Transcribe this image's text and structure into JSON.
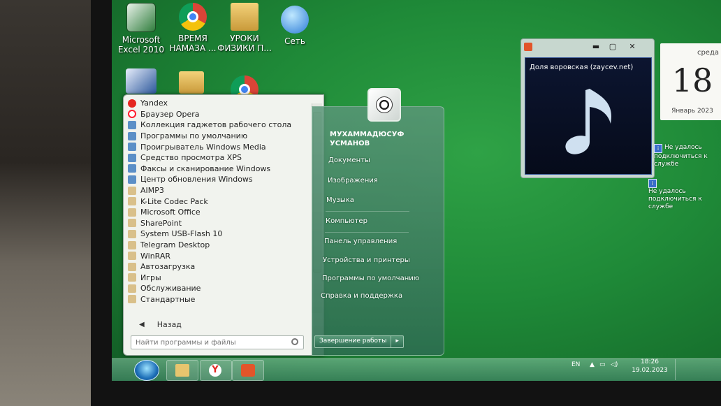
{
  "desktop": {
    "icons": [
      {
        "label": "Microsoft Excel 2010",
        "icon": "excel-icon"
      },
      {
        "label": "ВРЕМЯ НАМАЗА ...",
        "icon": "chrome-icon"
      },
      {
        "label": "УРОКИ ФИЗИКИ П...",
        "icon": "folder-icon"
      },
      {
        "label": "Сеть",
        "icon": "network-icon"
      }
    ]
  },
  "start_menu": {
    "programs": [
      {
        "label": "Yandex",
        "icon": "yandex-icon"
      },
      {
        "label": "Браузер Opera",
        "icon": "opera-icon"
      },
      {
        "label": "Коллекция гаджетов рабочего стола",
        "icon": "gadgets-icon"
      },
      {
        "label": "Программы по умолчанию",
        "icon": "defaults-icon"
      },
      {
        "label": "Проигрыватель Windows Media",
        "icon": "media-player-icon"
      },
      {
        "label": "Средство просмотра XPS",
        "icon": "xps-icon"
      },
      {
        "label": "Факсы и сканирование Windows",
        "icon": "fax-icon"
      },
      {
        "label": "Центр обновления Windows",
        "icon": "update-icon"
      },
      {
        "label": "AIMP3",
        "icon": "folder-icon"
      },
      {
        "label": "K-Lite Codec Pack",
        "icon": "folder-icon"
      },
      {
        "label": "Microsoft Office",
        "icon": "folder-icon"
      },
      {
        "label": "SharePoint",
        "icon": "folder-icon"
      },
      {
        "label": "System USB-Flash 10",
        "icon": "folder-icon"
      },
      {
        "label": "Telegram Desktop",
        "icon": "folder-icon"
      },
      {
        "label": "WinRAR",
        "icon": "folder-icon"
      },
      {
        "label": "Автозагрузка",
        "icon": "folder-icon"
      },
      {
        "label": "Игры",
        "icon": "folder-icon"
      },
      {
        "label": "Обслуживание",
        "icon": "folder-icon"
      },
      {
        "label": "Стандартные",
        "icon": "folder-icon"
      }
    ],
    "back_label": "Назад",
    "search_placeholder": "Найти программы и файлы",
    "user_name": "МУХАММАДЮСУФ УСМАНОВ",
    "right_links": [
      "Документы",
      "Изображения",
      "Музыка",
      "Компьютер",
      "Панель управления",
      "Устройства и принтеры",
      "Программы по умолчанию",
      "Справка и поддержка"
    ],
    "shutdown_label": "Завершение работы"
  },
  "media_gadget": {
    "track": "Доля воровская (zaycev.net)"
  },
  "calendar": {
    "weekday": "среда",
    "day": "18",
    "month_year": "Январь 2023"
  },
  "notices": [
    "Не удалось подключиться к службе",
    "Не удалось подключиться к службе"
  ],
  "taskbar": {
    "language": "EN",
    "time": "18:26",
    "date": "19.02.2023"
  },
  "colors": {
    "desktop_green": "#1f8a38",
    "start_panel": "#f1f3ee"
  }
}
